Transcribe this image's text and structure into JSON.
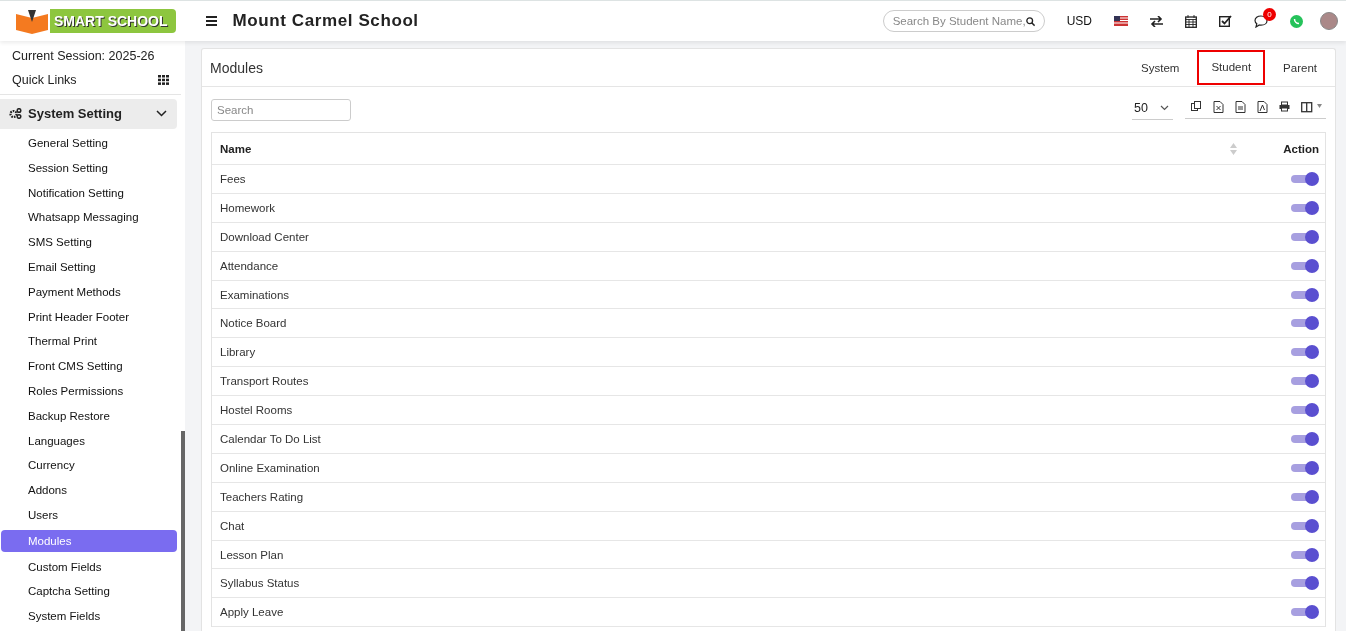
{
  "header": {
    "logo_text": "SMART SCHOOL",
    "school_name": "Mount Carmel School",
    "search": {
      "placeholder": "Search By Student Name,"
    },
    "currency": "USD",
    "chat_count": "0"
  },
  "sidebar": {
    "session": "Current Session: 2025-26",
    "quick_links": "Quick Links",
    "section": {
      "label": "System Setting",
      "expanded": true
    },
    "items": [
      {
        "label": "General Setting",
        "selected": false
      },
      {
        "label": "Session Setting",
        "selected": false
      },
      {
        "label": "Notification Setting",
        "selected": false
      },
      {
        "label": "Whatsapp Messaging",
        "selected": false
      },
      {
        "label": "SMS Setting",
        "selected": false
      },
      {
        "label": "Email Setting",
        "selected": false
      },
      {
        "label": "Payment Methods",
        "selected": false
      },
      {
        "label": "Print Header Footer",
        "selected": false
      },
      {
        "label": "Thermal Print",
        "selected": false
      },
      {
        "label": "Front CMS Setting",
        "selected": false
      },
      {
        "label": "Roles Permissions",
        "selected": false
      },
      {
        "label": "Backup Restore",
        "selected": false
      },
      {
        "label": "Languages",
        "selected": false
      },
      {
        "label": "Currency",
        "selected": false
      },
      {
        "label": "Addons",
        "selected": false
      },
      {
        "label": "Users",
        "selected": false
      },
      {
        "label": "Modules",
        "selected": true
      },
      {
        "label": "Custom Fields",
        "selected": false
      },
      {
        "label": "Captcha Setting",
        "selected": false
      },
      {
        "label": "System Fields",
        "selected": false
      }
    ]
  },
  "panel": {
    "title": "Modules",
    "tabs": [
      {
        "label": "System",
        "selected": false
      },
      {
        "label": "Student",
        "selected": true
      },
      {
        "label": "Parent",
        "selected": false
      }
    ],
    "search": {
      "placeholder": "Search"
    },
    "page_size": "50",
    "table": {
      "columns": [
        "Name",
        "Action"
      ],
      "rows": [
        {
          "name": "Fees",
          "on": true
        },
        {
          "name": "Homework",
          "on": true
        },
        {
          "name": "Download Center",
          "on": true
        },
        {
          "name": "Attendance",
          "on": true
        },
        {
          "name": "Examinations",
          "on": true
        },
        {
          "name": "Notice Board",
          "on": true
        },
        {
          "name": "Library",
          "on": true
        },
        {
          "name": "Transport Routes",
          "on": true
        },
        {
          "name": "Hostel Rooms",
          "on": true
        },
        {
          "name": "Calendar To Do List",
          "on": true
        },
        {
          "name": "Online Examination",
          "on": true
        },
        {
          "name": "Teachers Rating",
          "on": true
        },
        {
          "name": "Chat",
          "on": true
        },
        {
          "name": "Lesson Plan",
          "on": true
        },
        {
          "name": "Syllabus Status",
          "on": true
        },
        {
          "name": "Apply Leave",
          "on": true
        }
      ]
    }
  }
}
